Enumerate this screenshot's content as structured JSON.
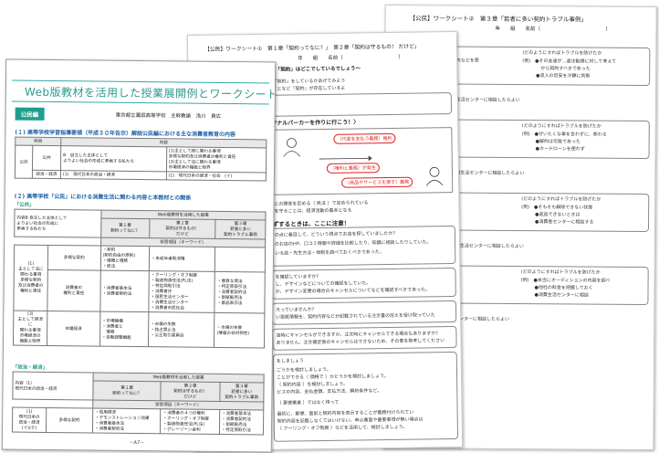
{
  "sheet3": {
    "header": "【公民】ワークシート②　第３章「若者に多い契約トラブル事例」",
    "name_line": "年　　組　　名前（　　　　　　　　　　　　　）",
    "sections": [
      {
        "title": "トラブル",
        "q1": "であったか?",
        "q2": "(どのようにすればトラブルを防げたか",
        "a1": "ナーで友だちが、稼働貯金の当先などを受",
        "b1": [
          "(例)　●その友達が…違法勧誘に対して考えて",
          "　　　　から契約すべきであった",
          "　　　●収入の目安を冷静に判断"
        ]
      },
      {
        "title": "こと)",
        "line": "に関わる必要はないので、消費生活センターに相談したらよい"
      },
      {
        "title": "トラブル",
        "q1": "であったか?",
        "q2": "(どのようにすればトラブルを防げたか",
        "a1": "ンチ電話があったが、",
        "b1": [
          "(例)　●ぜいたくな事を言わずに、断わる",
          "　　　●解約は可能であった",
          "　　　●カードローンを使わず"
        ]
      },
      {
        "title": "こと)",
        "line": "購入は契約を解除できない、消費生活センターに相談したらよい"
      },
      {
        "title": "トラブル",
        "q1": "であったか?",
        "q2": "(どのようにすればトラブルを防げたか",
        "a1": "用品の通信販売で",
        "b1": [
          "(例)　●そもそも解除できない状態",
          "　　　●返品できないときは",
          "　　　●消費者センターに相談する"
        ]
      },
      {
        "title": "こと)",
        "line": "と契約することができない。消費生活センターに相談したらよい"
      },
      {
        "title": "ションでのトラブル",
        "q1": "であったか?",
        "q2": "(どのようにすればトラブルを防げたか",
        "a1": "な場合があるという",
        "b1": [
          "(例)　●本当にオーディションの内容を調べ",
          "　　　●他社の料金を把握しておく",
          "　　　●消費生活センターに相談"
        ]
      },
      {
        "title": "こと)",
        "line": "には、一人で悩まず、消費生活センターに相談したらよい"
      }
    ]
  },
  "sheet2": {
    "header": "【公民】ワークシート①　第１章「契約ってなに？」　第２章「契約は守るもの！ だけど」",
    "name_line": "年　　組　　名前（　　　　　　　　　　　）",
    "sub_header": "〜「契約」はどこでしているでしょう〜",
    "intro": [
      "「契約」をしているかあげてみよう",
      "ことなど「契約」が存在しているよ"
    ],
    "section_heading": "ジナルパーカーを作りに行こう！〉",
    "illus": {
      "left": "（代金を支払う義務）権利",
      "mid": "（権利と義務）が発生",
      "right": "（商品やサービスを渡す）義務"
    },
    "law_line": "との関係を定める（ 民法 ）で定められている",
    "law_line2": "を守ることは、経済活動の基本となる",
    "q_head": "ずするときは、ここに注意！",
    "q_lines": [
      "の点に着目して、どういう視点でお店を探していましたか?",
      "のお店のHP、口コミ情報や詳細を比較したり、知識に相談したりしていた。",
      "いる店・先生方法・体制を調べておくべきであった。"
    ],
    "q2_head": "を確認していますか?",
    "q2_lines": [
      "し、デザインなどについての確認をしていた。",
      "か、デザイン変更の場合のキャンセルについてなどを確認すべきであった。"
    ],
    "q3_head": "ろっていませんか?",
    "q3_lines": [
      "い型紙情報を、契約内容などが記載されている注文書の控えを受け取っていた"
    ],
    "q4_line": "店時にキャンセルができますか。注文時にキャンセルできる場合もありますか?",
    "q4_ans": "ありません。注文確定後のキャンセルはできないため、その事を熟考してください",
    "q5_head": "をしましょう",
    "q5_lines": [
      "ごうかを検討しましょう。",
      "ことができる（ 価格で ）かどうかを検討しましょう。",
      "（ 契約内容 ）を検討しましょう。",
      "ビスの内容、支払金額、支払方法、解約条件など。"
    ],
    "q6_line": "（ 悪徳業者 ）ではなく待って",
    "q7_lines": [
      "最初に、郵便、面前と契約内容を表示することが義務付けられてい",
      "契約内容を記載しなくてはいけない。申込書面や重要事項が無い場合は",
      "（ クーリング・オフ制度 ）などを活用して、検討しましょう。"
    ]
  },
  "sheet1": {
    "title": "Web版教材を活用した授業展開例とワークシート",
    "badge": "公民編",
    "author": "東京都立葛田高等学校　主幹教諭　浅川　貴広",
    "h1": "(１) 高等学校学習指導要領（平成３０年告示）解説公民編における主な消費者教育の内容",
    "t1": {
      "headers": [
        "科目",
        "内容"
      ],
      "rows": [
        [
          "公共",
          "公共",
          "B　自立した主体として\nよりよい社会の形成に参画する私たち",
          "(1)主として経に関わる事項\n多様な契約及び消費者の権利と責任\n(3)主として法に関わる事項\n市場経済の機能と限界"
        ],
        [
          "",
          "政治・経済",
          "(1)　現代日本の政治・経済",
          "(1)　現代日本の経済・社会　(イ)"
        ]
      ]
    },
    "h2": "(２) 高等学校「公民」における消費生活に関わる内容と本教材との関係",
    "sub1": "「公共」",
    "t2": {
      "top_left": "内容B 自立した主体として\nよりよい社会の形成に\n参画する私たち",
      "web_head": "Web版教材を活用した授業",
      "cols": [
        "第１章\n契約ってなに？",
        "第２章\n契約は守るもの！\nだけど",
        "第３章\n若者に多い\n契約トラブル事例"
      ],
      "learn_head": "学習項目（キーワード）",
      "rows": [
        {
          "a": "(1)\n主として法に\n関わる事項\n多様な契約\n及び消費者の\n権利と責任",
          "b": "多様な契約",
          "c1": "・契約\n(契約自由の原則)\n・債権と債務\n・民法",
          "c2": "・未成年者取消権",
          "c3": ""
        },
        {
          "a": "",
          "b": "消費者の\n権利と責任",
          "c1": "・消費者基本法\n・消費者契約法",
          "c2": "・クーリング・オフ制度\n・製造物責任法(PL法)\n・特定商取引法\n・消費者庁\n・国民生活センター\n・消費生活センター\n・消費者市民社会",
          "c3": "・悪質な商法\n・特定商取引法\n・消費者契約法\n・割賦販売法\n・景品表示法"
        },
        {
          "a": "(3)\n主として経済に\n関わる事項\n市場経済の\n機能と限界",
          "b": "市場経済",
          "c1": "・市場機構\n・消費者と\n　情報\n・自動調整機能",
          "c2": "・市場の失敗\n・独占禁止法\n・公正取引委員会",
          "c3": "・市場の失敗\n(情報の非対称性)"
        }
      ]
    },
    "sub2": "「政治・経済」",
    "t3": {
      "top_left": "内容（1）\n現代日本の政治・経済",
      "web_head": "Web版教材を活用した授業",
      "cols": [
        "第１章\n契約ってなに？",
        "第２章\n契約は守るもの！\nだけど",
        "第３章\n若者に多い\n契約トラブル事例"
      ],
      "learn_head": "学習項目（キーワード）",
      "rows": [
        {
          "a": "(1)\n現代日本の\n政治・経済\n(イ)(ク)",
          "b": "多様な契約",
          "c1": "・信用経済\n・デモンストレーション効果\n・消費者基本法\n・消費者契約法",
          "c2": "・消費者の４つの権利\n・クーリング・オフ制度\n・製造物責任法(PL法)\n・グレーゾーン金利",
          "c3": "・消費者基本法\n・消費者契約法\n・割賦販売法\n・特定商取引法"
        }
      ]
    },
    "page_no": "－A7－"
  }
}
